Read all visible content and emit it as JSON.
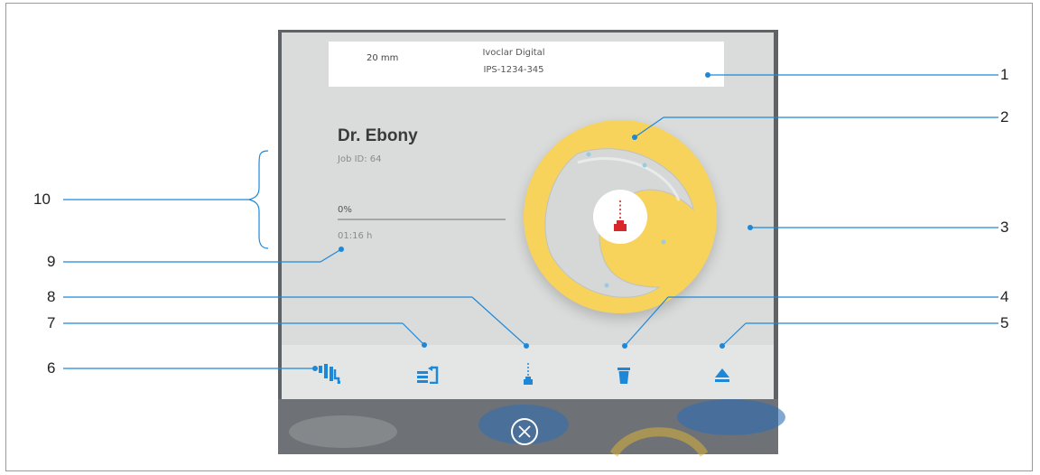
{
  "info": {
    "size": "20 mm",
    "brand": "Ivoclar Digital",
    "code": "IPS-1234-345"
  },
  "job": {
    "patient": "Dr. Ebony",
    "job_id": "Job ID: 64",
    "progress_text": "0%",
    "progress": 0,
    "time": "01:16 h"
  },
  "toolbar": {
    "icons": [
      "insert-job-icon",
      "queue-job-icon",
      "mill-tool-icon",
      "delete-icon",
      "eject-icon"
    ]
  },
  "colors": {
    "accent_blue": "#1e88d8",
    "disc_yellow": "#f7d35c",
    "tool_red": "#d9262b"
  },
  "callouts": [
    "1",
    "2",
    "3",
    "4",
    "5",
    "6",
    "7",
    "8",
    "9",
    "10"
  ]
}
